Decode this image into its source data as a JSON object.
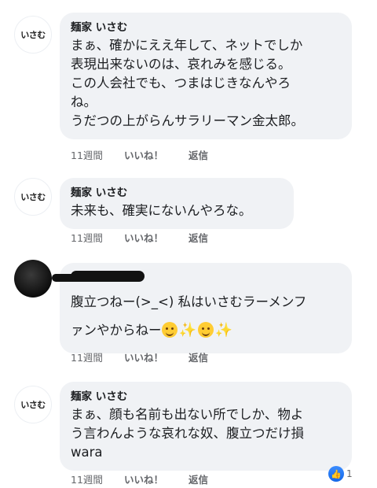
{
  "comments": [
    {
      "author": "麺家 いさむ",
      "avatar_text": "いさむ",
      "lines": [
        "まぁ、確かにええ年して、ネットでしか",
        "表現出来ないのは、哀れみを感じる。",
        "この人会社でも、つまはじきなんやろ",
        "ね。",
        "うだつの上がらんサラリーマン金太郎。"
      ],
      "time": "11週間",
      "like": "いいね！",
      "reply": "返信"
    },
    {
      "author": "麺家 いさむ",
      "avatar_text": "いさむ",
      "lines": [
        "未来も、確実にないんやろな。"
      ],
      "time": "11週間",
      "like": "いいね！",
      "reply": "返信"
    },
    {
      "author": "",
      "lines": [
        "腹立つねー(>_<) 私はいさむラーメンフ",
        "ァンやからねー"
      ],
      "time": "11週間",
      "like": "いいね！",
      "reply": "返信"
    },
    {
      "author": "麺家 いさむ",
      "avatar_text": "いさむ",
      "lines": [
        "まぁ、顔も名前も出ない所でしか、物よ",
        "う言わんような哀れな奴、腹立つだけ損",
        "wara"
      ],
      "time": "11週間",
      "like": "いいね！",
      "reply": "返信",
      "reaction_count": "1"
    }
  ],
  "icons": {
    "like_reaction": "thumbs-up-icon",
    "emoji": "smiling-face-emoji",
    "sparkles": "sparkles-emoji"
  },
  "colors": {
    "bubble": "#f0f2f5",
    "meta": "#65676b",
    "like_blue": "#1877f2"
  }
}
